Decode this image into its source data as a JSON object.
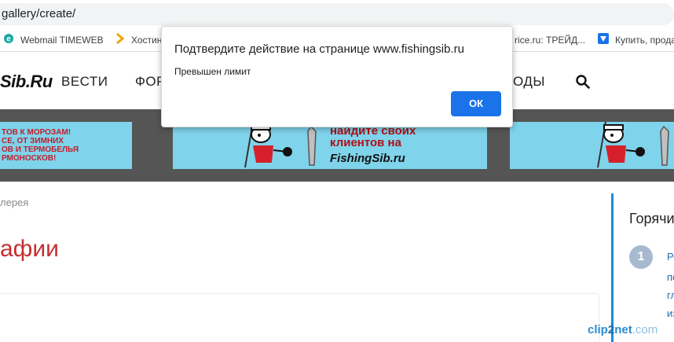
{
  "browser": {
    "url": "gallery/create/",
    "bookmarks": [
      {
        "label": "Webmail TIMEWEB",
        "icon": "webmail-icon"
      },
      {
        "label": "Хостин",
        "icon": "bookmark-arrow-icon"
      },
      {
        "label": "rice.ru: ТРЕЙД...",
        "icon": "bookmark-icon"
      },
      {
        "label": "Купить, прода",
        "icon": "shop-icon"
      }
    ]
  },
  "site": {
    "logo": "Sib.Ru",
    "nav": {
      "item1": "ВЕСТИ",
      "item2": "ФОР",
      "item3": "ОДЫ"
    },
    "banners": {
      "left_text": "ТОВ К МОРОЗАМ!\nСЕ, ОТ ЗИМНИХ\nОВ И ТЕРМОБЕЛЬЯ\nРМОНОСКОВ!",
      "center_text": "найдите своих\nклиентов на",
      "center_brand": "FishingSib.ru"
    },
    "breadcrumb": "лерея",
    "page_title": "афии",
    "sidebar": {
      "title": "Горячи",
      "number": "1",
      "lines": [
        "Ре",
        "по",
        "гл",
        "из"
      ]
    }
  },
  "dialog": {
    "title": "Подтвердите действие на странице www.fishingsib.ru",
    "message": "Превышен лимит",
    "ok_label": "ОК"
  },
  "watermark": {
    "part1": "clip",
    "part2": "2",
    "part3": "net",
    "domain": ".com"
  },
  "colors": {
    "accent": "#1a73e8",
    "title_red": "#c62e2e",
    "banner_bg": "#7fd3ea",
    "strip_bg": "#555555",
    "sidebar_border": "#1b8ad6"
  }
}
